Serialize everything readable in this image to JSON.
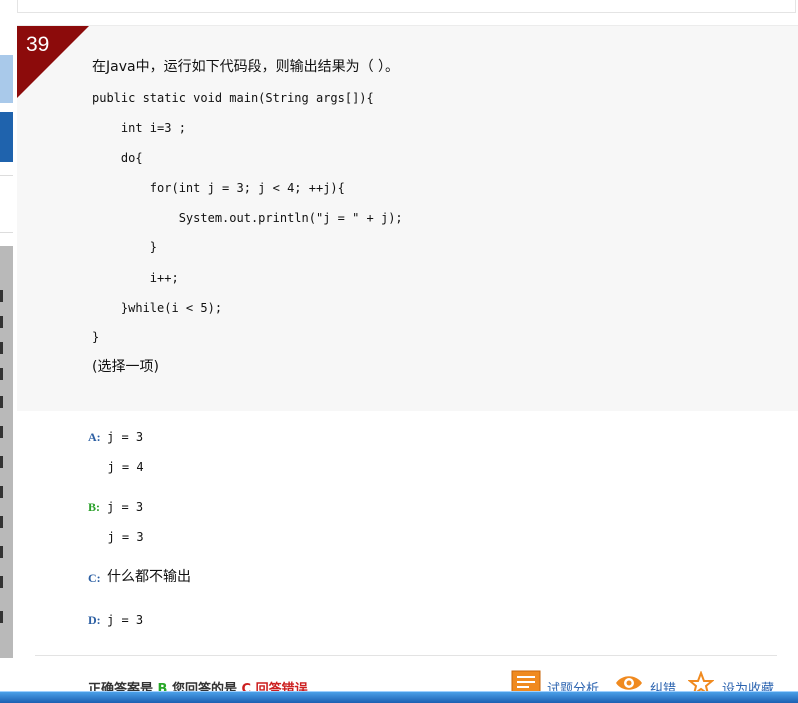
{
  "question": {
    "number": "39",
    "prompt": "在Java中，运行如下代码段，则输出结果为（ ）。",
    "code_lines": [
      "public static void main(String args[]){",
      "    int i=3 ;",
      "    do{",
      "        for(int j = 3; j < 4; ++j){",
      "            System.out.println(\"j = \" + j);",
      "        }",
      "        i++;",
      "    }while(i < 5);",
      "}"
    ],
    "hint": "(选择一项)"
  },
  "options": [
    {
      "letter": "A:",
      "lines": [
        "j = 3",
        "  j = 4"
      ]
    },
    {
      "letter": "B:",
      "lines": [
        "j = 3",
        "  j = 3"
      ]
    },
    {
      "letter": "C:",
      "lines": [
        "什么都不输出"
      ]
    },
    {
      "letter": "D:",
      "lines": [
        "j = 3"
      ]
    }
  ],
  "result": {
    "correct_label": "正确答案是",
    "correct_value": "B",
    "your_label": "您回答的是",
    "your_value": "C",
    "status": "回答错误"
  },
  "actions": {
    "analysis": "试题分析",
    "correction": "纠错",
    "favorite": "设为收藏"
  },
  "colors": {
    "badge": "#8c0b0b",
    "correct": "#2aa02a",
    "wrong": "#cc1f1f",
    "link": "#2c64b0",
    "option_letter": "#2c5fa3"
  }
}
